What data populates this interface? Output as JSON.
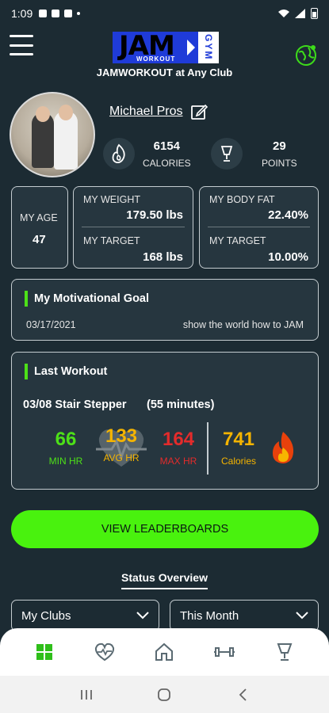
{
  "status_bar": {
    "time": "1:09"
  },
  "header": {
    "club": "JAMWORKOUT at Any Club",
    "logo": {
      "big": "JAM",
      "small": "WORKOUT",
      "side": "GYM"
    }
  },
  "profile": {
    "name": "Michael Pros",
    "calories_value": "6154",
    "calories_label": "CALORIES",
    "points_value": "29",
    "points_label": "POINTS"
  },
  "metrics": {
    "age_label": "MY AGE",
    "age_value": "47",
    "weight_label": "MY WEIGHT",
    "weight_value": "179.50 lbs",
    "weight_target_label": "MY TARGET",
    "weight_target_value": "168 lbs",
    "fat_label": "MY BODY FAT",
    "fat_value": "22.40%",
    "fat_target_label": "MY TARGET",
    "fat_target_value": "10.00%"
  },
  "goal": {
    "title": "My Motivational Goal",
    "date": "03/17/2021",
    "text": "show the world how to JAM"
  },
  "last_workout": {
    "title": "Last Workout",
    "activity": "03/08 Stair Stepper",
    "duration": "(55 minutes)",
    "min_hr": "66",
    "min_label": "MIN HR",
    "avg_hr": "133",
    "avg_label": "AVG HR",
    "max_hr": "164",
    "max_label": "MAX HR",
    "calories": "741",
    "calories_label": "Calories"
  },
  "leaderboard_button": "VIEW LEADERBOARDS",
  "status_overview": {
    "title": "Status Overview",
    "club_select": "My Clubs",
    "period_select": "This Month"
  },
  "colors": {
    "accent": "#49f20e",
    "min": "#4de018",
    "avg": "#f5b400",
    "max": "#e32b2b",
    "cal": "#f5b400",
    "bg": "#1c2b33",
    "card": "#26363f"
  }
}
